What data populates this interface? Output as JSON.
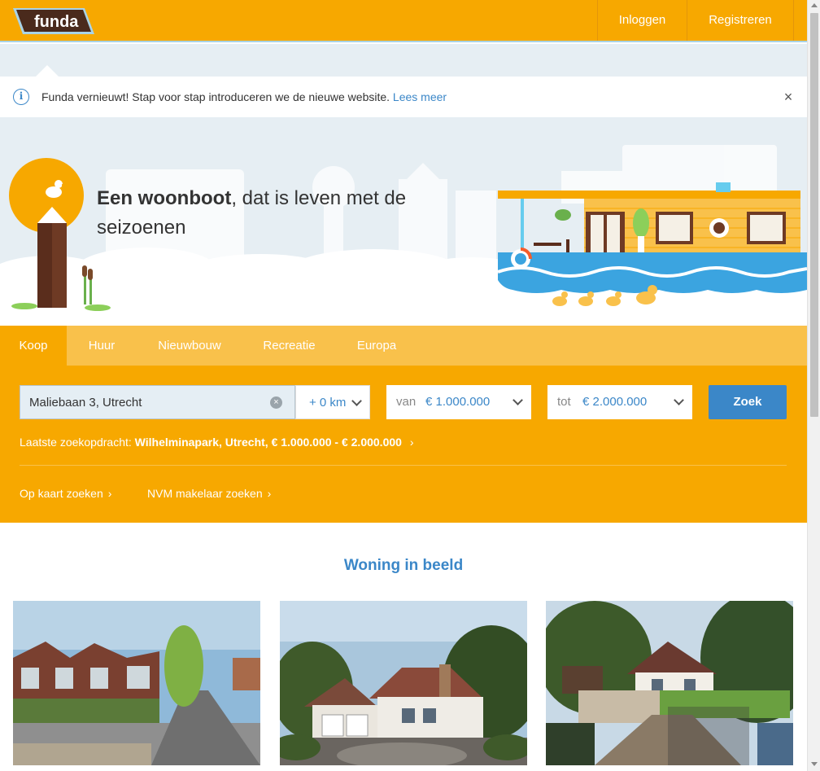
{
  "header": {
    "logo_text": "funda",
    "login_label": "Inloggen",
    "register_label": "Registreren"
  },
  "notification": {
    "icon": "info-icon",
    "text": "Funda vernieuwt! Stap voor stap introduceren we de nieuwe website.",
    "link_label": "Lees meer",
    "close_icon": "close-icon"
  },
  "hero": {
    "title_bold": "Een woonboot",
    "title_rest": ", dat is leven met de seizoenen"
  },
  "search": {
    "tabs": [
      {
        "label": "Koop",
        "active": true
      },
      {
        "label": "Huur",
        "active": false
      },
      {
        "label": "Nieuwbouw",
        "active": false
      },
      {
        "label": "Recreatie",
        "active": false
      },
      {
        "label": "Europa",
        "active": false
      }
    ],
    "location_value": "Maliebaan 3, Utrecht",
    "radius_value": "+ 0 km",
    "price_from_label": "van",
    "price_from_value": "€ 1.000.000",
    "price_to_label": "tot",
    "price_to_value": "€ 2.000.000",
    "submit_label": "Zoek",
    "last_search_label": "Laatste zoekopdracht:",
    "last_search_value": "Wilhelminapark, Utrecht, € 1.000.000 - € 2.000.000",
    "map_link": "Op kaart zoeken",
    "nvm_link": "NVM makelaar zoeken"
  },
  "section": {
    "title": "Woning in beeld"
  },
  "colors": {
    "brand_orange": "#f7a800",
    "tab_bar": "#f9c14b",
    "link_blue": "#3b87c8",
    "sky": "#e6eef3"
  }
}
